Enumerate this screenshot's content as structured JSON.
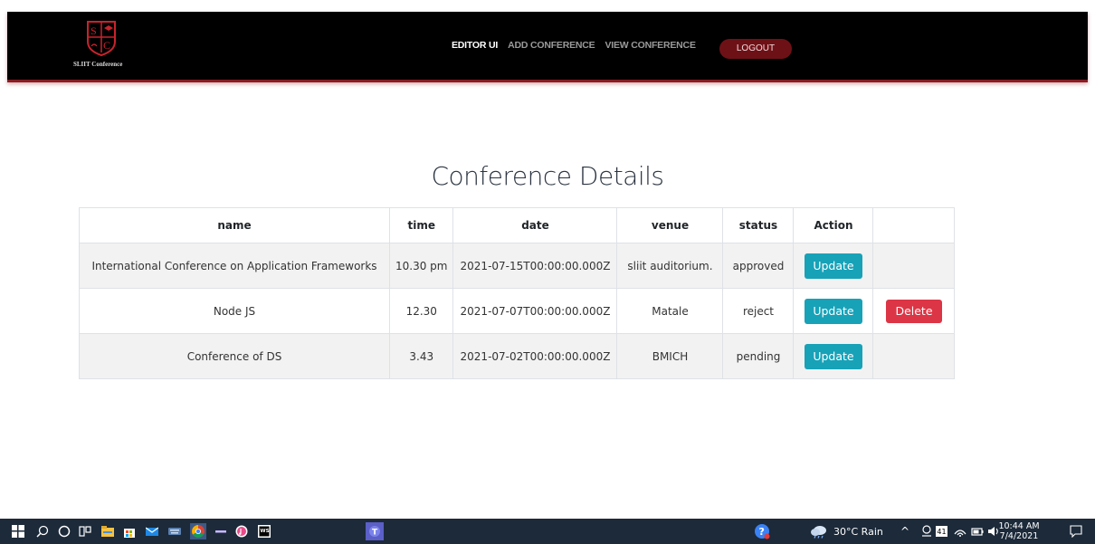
{
  "header": {
    "brand_name": "SLIIT Conference",
    "logo_letters": [
      "S",
      "C"
    ],
    "nav": [
      {
        "label": "EDITOR UI",
        "active": true
      },
      {
        "label": "ADD CONFERENCE",
        "active": false
      },
      {
        "label": "VIEW CONFERENCE",
        "active": false
      }
    ],
    "logout_label": "LOGOUT"
  },
  "main": {
    "title": "Conference Details",
    "table": {
      "columns": [
        "name",
        "time",
        "date",
        "venue",
        "status",
        "Action",
        ""
      ],
      "rows": [
        {
          "name": "International Conference on Application Frameworks",
          "time": "10.30 pm",
          "date": "2021-07-15T00:00:00.000Z",
          "venue": "sliit auditorium.",
          "status": "approved",
          "update_label": "Update",
          "delete_label": ""
        },
        {
          "name": "Node JS",
          "time": "12.30",
          "date": "2021-07-07T00:00:00.000Z",
          "venue": "Matale",
          "status": "reject",
          "update_label": "Update",
          "delete_label": "Delete"
        },
        {
          "name": "Conference of DS",
          "time": "3.43",
          "date": "2021-07-02T00:00:00.000Z",
          "venue": "BMICH",
          "status": "pending",
          "update_label": "Update",
          "delete_label": ""
        }
      ]
    }
  },
  "taskbar": {
    "weather": "30°C Rain",
    "time": "10:44 AM",
    "date": "7/4/2021",
    "badge_count": "41",
    "pinned_icons": [
      "windows-start-icon",
      "search-icon",
      "cortana-icon",
      "task-view-icon",
      "file-explorer-icon",
      "store-icon",
      "mail-icon",
      "keyboard-icon",
      "chrome-icon",
      "app-icon",
      "itunes-icon",
      "webstorm-icon",
      "teams-icon"
    ]
  },
  "colors": {
    "navbar_bg": "#000000",
    "navbar_accent": "#8b1c23",
    "logout_bg": "#6e1117",
    "update_btn": "#17a2b8",
    "delete_btn": "#dc3545",
    "taskbar_bg": "#1c2a3a"
  }
}
